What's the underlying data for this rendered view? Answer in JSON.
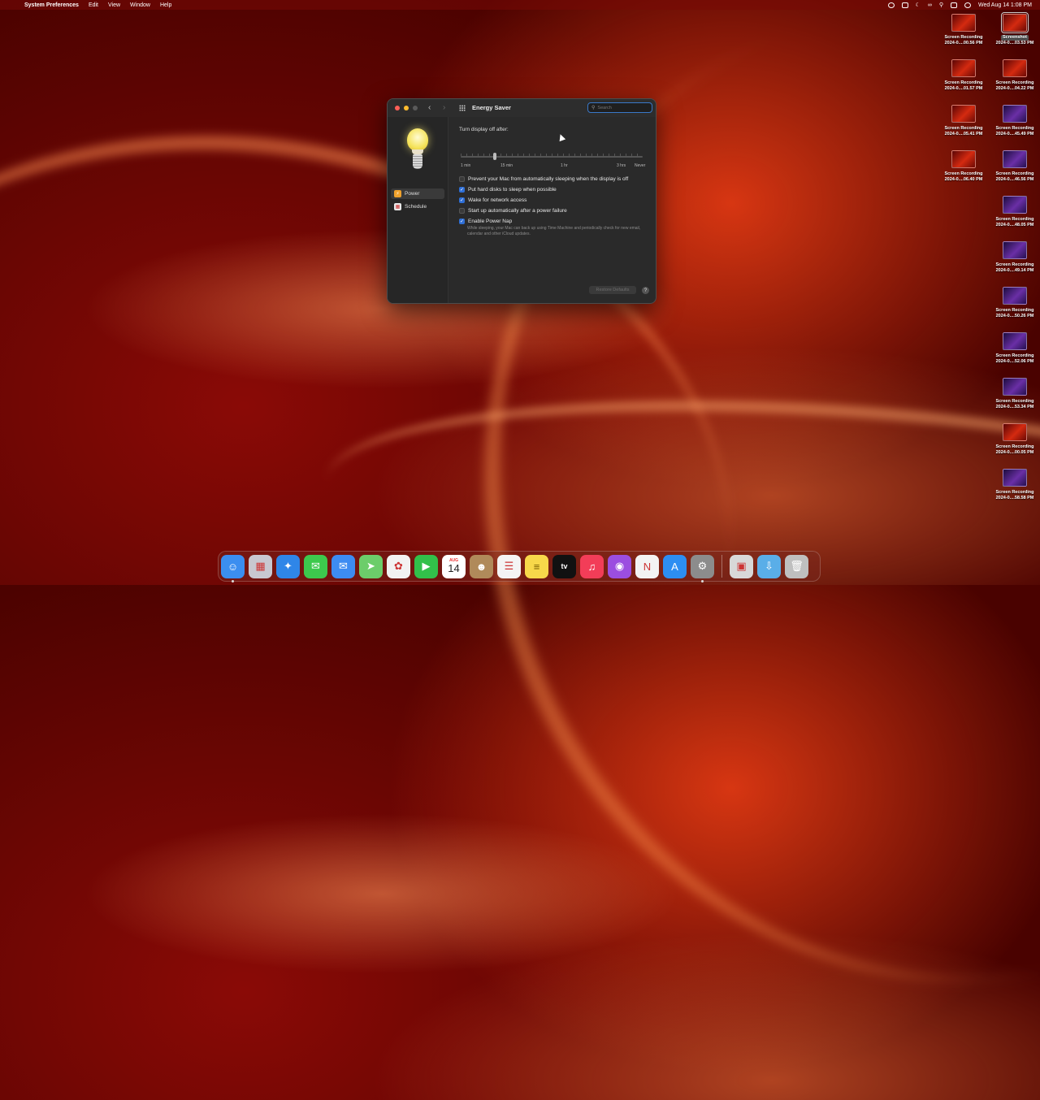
{
  "menubar": {
    "app_name": "System Preferences",
    "menus": [
      "Edit",
      "View",
      "Window",
      "Help"
    ],
    "clock": "Wed Aug 14  1:08 PM"
  },
  "window": {
    "title": "Energy Saver",
    "search_placeholder": "Search",
    "sidebar": [
      {
        "label": "Power",
        "icon": "power-bolt-icon",
        "active": true
      },
      {
        "label": "Schedule",
        "icon": "calendar-icon",
        "active": false
      }
    ],
    "display_off_label": "Turn display off after:",
    "slider_ticks": [
      "1 min",
      "15 min",
      "1 hr",
      "3 hrs",
      "Never"
    ],
    "options": [
      {
        "label": "Prevent your Mac from automatically sleeping when the display is off",
        "checked": false
      },
      {
        "label": "Put hard disks to sleep when possible",
        "checked": true
      },
      {
        "label": "Wake for network access",
        "checked": true
      },
      {
        "label": "Start up automatically after a power failure",
        "checked": false
      },
      {
        "label": "Enable Power Nap",
        "checked": true
      }
    ],
    "power_nap_description": "While sleeping, your Mac can back up using Time Machine and periodically check for new email, calendar and other iCloud updates.",
    "restore_defaults": "Restore Defaults",
    "help": "?"
  },
  "desktop_icons": [
    {
      "name": "Screenshot",
      "date": "2024-0....03.53 PM",
      "thumb": "red",
      "selected": true
    },
    {
      "name": "Screen Recording",
      "date": "2024-0....00.56 PM",
      "thumb": "red"
    },
    {
      "name": "Screen Recording",
      "date": "2024-0....01.57 PM",
      "thumb": "red"
    },
    {
      "name": "Screen Recording",
      "date": "2024-0....04.22 PM",
      "thumb": "red"
    },
    {
      "name": "Screen Recording",
      "date": "2024-0....05.41 PM",
      "thumb": "red"
    },
    {
      "name": "Screen Recording",
      "date": "2024-0....45.49 PM",
      "thumb": "purple"
    },
    {
      "name": "Screen Recording",
      "date": "2024-0....06.40 PM",
      "thumb": "red"
    },
    {
      "name": "Screen Recording",
      "date": "2024-0....46.56 PM",
      "thumb": "purple"
    },
    {
      "name": "Screen Recording",
      "date": "2024-0....48.05 PM",
      "thumb": "purple"
    },
    {
      "name": "Screen Recording",
      "date": "2024-0....49.14 PM",
      "thumb": "purple"
    },
    {
      "name": "Screen Recording",
      "date": "2024-0....50.26 PM",
      "thumb": "purple"
    },
    {
      "name": "Screen Recording",
      "date": "2024-0....52.06 PM",
      "thumb": "purple"
    },
    {
      "name": "Screen Recording",
      "date": "2024-0....53.34 PM",
      "thumb": "purple"
    },
    {
      "name": "Screen Recording",
      "date": "2024-0....00.05 PM",
      "thumb": "red"
    },
    {
      "name": "Screen Recording",
      "date": "2024-0....58.58 PM",
      "thumb": "purple"
    }
  ],
  "dock": {
    "calendar_month": "AUG",
    "calendar_day": "14",
    "tv_label": "tv",
    "apps": [
      {
        "name": "finder-icon",
        "color": "#3b8ef0"
      },
      {
        "name": "launchpad-icon",
        "color": "#c8c8d0"
      },
      {
        "name": "safari-icon",
        "color": "#2f86e8"
      },
      {
        "name": "messages-icon",
        "color": "#3dc94d"
      },
      {
        "name": "mail-icon",
        "color": "#3d8cf2"
      },
      {
        "name": "maps-icon",
        "color": "#6ccd6a"
      },
      {
        "name": "photos-icon",
        "color": "#f2f2f2"
      },
      {
        "name": "facetime-icon",
        "color": "#32c04a"
      },
      {
        "name": "calendar-icon",
        "color": "#ffffff"
      },
      {
        "name": "contacts-icon",
        "color": "#b08a5a"
      },
      {
        "name": "reminders-icon",
        "color": "#f4f4f4"
      },
      {
        "name": "notes-icon",
        "color": "#f7d84a"
      },
      {
        "name": "apple-tv-icon",
        "color": "#111111"
      },
      {
        "name": "music-icon",
        "color": "#f23d58"
      },
      {
        "name": "podcasts-icon",
        "color": "#9b4ee0"
      },
      {
        "name": "news-icon",
        "color": "#f3f3f3"
      },
      {
        "name": "app-store-icon",
        "color": "#2d8ef2"
      },
      {
        "name": "system-preferences-icon",
        "color": "#8c8c8c"
      },
      {
        "name": "preview-icon",
        "color": "#d8d8d8"
      },
      {
        "name": "downloads-folder-icon",
        "color": "#5aaee8"
      },
      {
        "name": "trash-icon",
        "color": "#bfbfbf"
      }
    ]
  }
}
